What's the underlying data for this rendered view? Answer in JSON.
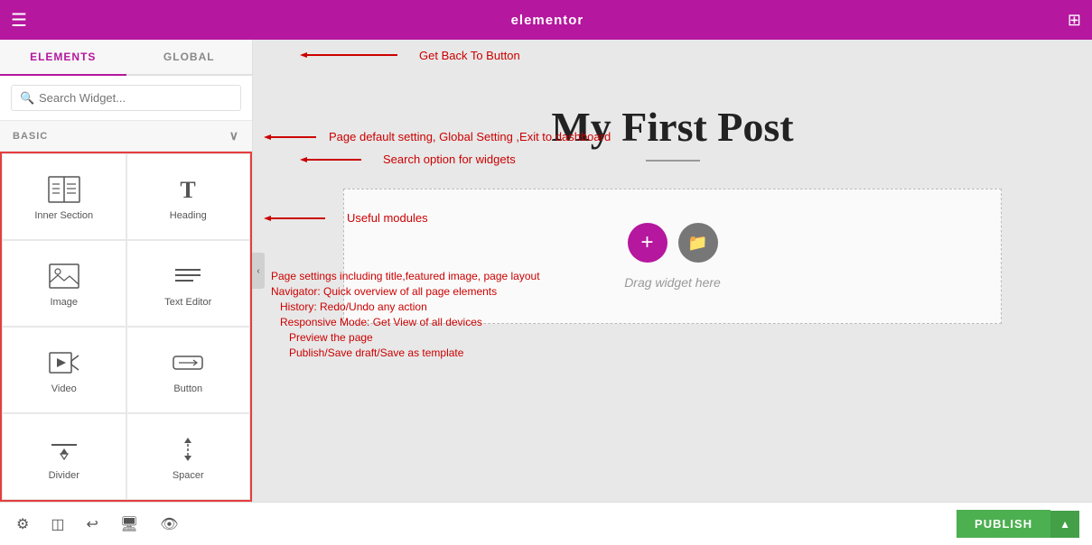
{
  "topbar": {
    "logo": "elementor",
    "menu_icon": "☰",
    "grid_icon": "⊞"
  },
  "sidebar": {
    "tabs": [
      {
        "label": "ELEMENTS",
        "active": true
      },
      {
        "label": "GLOBAL",
        "active": false
      }
    ],
    "search_placeholder": "Search Widget...",
    "category": "BASIC",
    "widgets": [
      {
        "id": "inner-section",
        "label": "Inner Section",
        "icon": "inner-section"
      },
      {
        "id": "heading",
        "label": "Heading",
        "icon": "heading"
      },
      {
        "id": "image",
        "label": "Image",
        "icon": "image"
      },
      {
        "id": "text-editor",
        "label": "Text Editor",
        "icon": "text-editor"
      },
      {
        "id": "video",
        "label": "Video",
        "icon": "video"
      },
      {
        "id": "button",
        "label": "Button",
        "icon": "button"
      },
      {
        "id": "divider",
        "label": "Divider",
        "icon": "divider"
      },
      {
        "id": "spacer",
        "label": "Spacer",
        "icon": "spacer"
      }
    ]
  },
  "canvas": {
    "page_title": "My First Post",
    "drop_text": "Drag widget here"
  },
  "annotations": [
    {
      "text": "Get Back To Button",
      "top": "4",
      "left": "340"
    },
    {
      "text": "Page default setting, Global Setting ,Exit to dashboard",
      "top": "142",
      "left": "340"
    },
    {
      "text": "Search option for widgets",
      "top": "172",
      "left": "340"
    },
    {
      "text": "Useful modules",
      "top": "218",
      "left": "340"
    },
    {
      "text": "Page settings including title,featured image, page layout",
      "top": "395",
      "left": "310"
    },
    {
      "text": "Navigator: Quick overview of all page elements",
      "top": "413",
      "left": "310"
    },
    {
      "text": "History: Redo/Undo any action",
      "top": "431",
      "left": "320"
    },
    {
      "text": "Responsive Mode: Get View of all devices",
      "top": "449",
      "left": "320"
    },
    {
      "text": "Preview the page",
      "top": "467",
      "left": "340"
    },
    {
      "text": "Publish/Save draft/Save as template",
      "top": "485",
      "left": "340"
    }
  ],
  "bottombar": {
    "icons": [
      "⚙",
      "◫",
      "↩",
      "☰",
      "👁"
    ],
    "publish_label": "PUBLISH",
    "arrow_label": "▲"
  }
}
